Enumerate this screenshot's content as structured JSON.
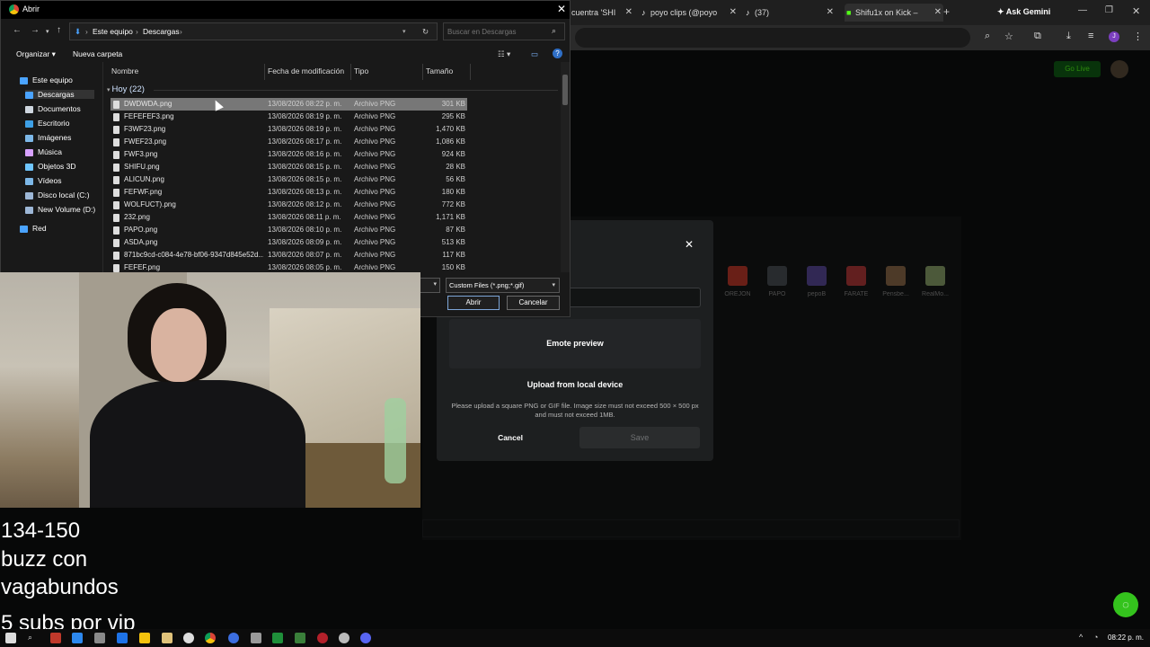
{
  "browser": {
    "tabs": [
      {
        "title": "cuentra 'SHI"
      },
      {
        "title": "poyo clips (@poyo"
      },
      {
        "title": "(37)"
      },
      {
        "title": "Shifu1x on Kick –"
      }
    ],
    "new_tab": "+",
    "ask_gemini": "Ask Gemini",
    "go_live": "Go Live",
    "emotes": [
      {
        "label": "OREJON",
        "color": "#c0392b"
      },
      {
        "label": "PAPO",
        "color": "#4a4f55"
      },
      {
        "label": "pepoB",
        "color": "#5a4a9a"
      },
      {
        "label": "FARATE",
        "color": "#b33a3a"
      },
      {
        "label": "Pensbe...",
        "color": "#8d6a4a"
      },
      {
        "label": "RealMo...",
        "color": "#8aa36a"
      }
    ]
  },
  "modal": {
    "close": "✕",
    "preview_label": "Emote preview",
    "upload_label": "Upload from local device",
    "help": "Please upload a square PNG or GIF file. Image size must not exceed 500 × 500 px and must not exceed 1MB.",
    "cancel": "Cancel",
    "save": "Save"
  },
  "dialog": {
    "title": "Abrir",
    "breadcrumb": [
      "Este equipo",
      "Descargas"
    ],
    "search_placeholder": "Buscar en Descargas",
    "organize": "Organizar ▾",
    "new_folder": "Nueva carpeta",
    "nav": [
      {
        "label": "Este equipo",
        "color": "#4aa3ff"
      },
      {
        "label": "Descargas",
        "color": "#4aa3ff"
      },
      {
        "label": "Documentos",
        "color": "#cfd7e0"
      },
      {
        "label": "Escritorio",
        "color": "#3ea0e6"
      },
      {
        "label": "Imágenes",
        "color": "#7db8e8"
      },
      {
        "label": "Música",
        "color": "#d7a1ff"
      },
      {
        "label": "Objetos 3D",
        "color": "#6fc6ff"
      },
      {
        "label": "Vídeos",
        "color": "#7db8e8"
      },
      {
        "label": "Disco local (C:)",
        "color": "#9db7d6"
      },
      {
        "label": "New Volume (D:)",
        "color": "#9db7d6"
      },
      {
        "label": "Red",
        "color": "#4aa3ff"
      }
    ],
    "columns": [
      "Nombre",
      "Fecha de modificación",
      "Tipo",
      "Tamaño"
    ],
    "group": "Hoy (22)",
    "files": [
      {
        "name": "DWDWDA.png",
        "date": "13/08/2026 08:22 p. m.",
        "type": "Archivo PNG",
        "size": "301 KB"
      },
      {
        "name": "FEFEFEF3.png",
        "date": "13/08/2026 08:19 p. m.",
        "type": "Archivo PNG",
        "size": "295 KB"
      },
      {
        "name": "F3WF23.png",
        "date": "13/08/2026 08:19 p. m.",
        "type": "Archivo PNG",
        "size": "1,470 KB"
      },
      {
        "name": "FWEF23.png",
        "date": "13/08/2026 08:17 p. m.",
        "type": "Archivo PNG",
        "size": "1,086 KB"
      },
      {
        "name": "FWF3.png",
        "date": "13/08/2026 08:16 p. m.",
        "type": "Archivo PNG",
        "size": "924 KB"
      },
      {
        "name": "SHIFU.png",
        "date": "13/08/2026 08:15 p. m.",
        "type": "Archivo PNG",
        "size": "28 KB"
      },
      {
        "name": "ALICUN.png",
        "date": "13/08/2026 08:15 p. m.",
        "type": "Archivo PNG",
        "size": "56 KB"
      },
      {
        "name": "FEFWF.png",
        "date": "13/08/2026 08:13 p. m.",
        "type": "Archivo PNG",
        "size": "180 KB"
      },
      {
        "name": "WOLFUCT).png",
        "date": "13/08/2026 08:12 p. m.",
        "type": "Archivo PNG",
        "size": "772 KB"
      },
      {
        "name": "232.png",
        "date": "13/08/2026 08:11 p. m.",
        "type": "Archivo PNG",
        "size": "1,171 KB"
      },
      {
        "name": "PAPO.png",
        "date": "13/08/2026 08:10 p. m.",
        "type": "Archivo PNG",
        "size": "87 KB"
      },
      {
        "name": "ASDA.png",
        "date": "13/08/2026 08:09 p. m.",
        "type": "Archivo PNG",
        "size": "513 KB"
      },
      {
        "name": "871bc9cd-c084-4e78-bf06-9347d845e52d...",
        "date": "13/08/2026 08:07 p. m.",
        "type": "Archivo PNG",
        "size": "117 KB"
      },
      {
        "name": "FEFEF.png",
        "date": "13/08/2026 08:05 p. m.",
        "type": "Archivo PNG",
        "size": "150 KB"
      }
    ],
    "file_type": "Custom Files (*.png;*.gif)",
    "open_button": "Abrir",
    "cancel_button": "Cancelar"
  },
  "stream_text": {
    "line1": "134-150",
    "line2": "buzz con",
    "line3": "vagabundos",
    "line4": "5 subs por vip"
  },
  "taskbar": {
    "time": "08:22 p. m."
  }
}
